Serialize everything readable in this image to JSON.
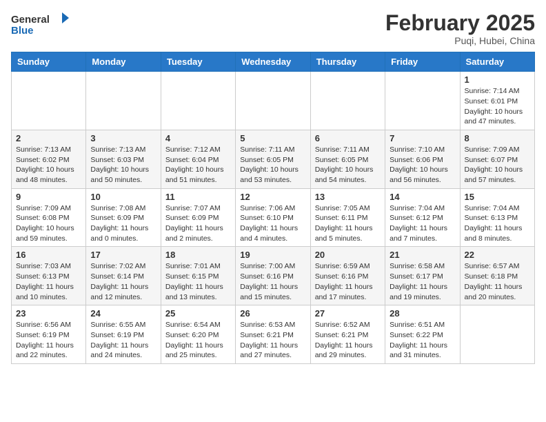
{
  "header": {
    "logo_line1": "General",
    "logo_line2": "Blue",
    "month_title": "February 2025",
    "subtitle": "Puqi, Hubei, China"
  },
  "weekdays": [
    "Sunday",
    "Monday",
    "Tuesday",
    "Wednesday",
    "Thursday",
    "Friday",
    "Saturday"
  ],
  "weeks": [
    [
      {
        "day": "",
        "info": ""
      },
      {
        "day": "",
        "info": ""
      },
      {
        "day": "",
        "info": ""
      },
      {
        "day": "",
        "info": ""
      },
      {
        "day": "",
        "info": ""
      },
      {
        "day": "",
        "info": ""
      },
      {
        "day": "1",
        "info": "Sunrise: 7:14 AM\nSunset: 6:01 PM\nDaylight: 10 hours\nand 47 minutes."
      }
    ],
    [
      {
        "day": "2",
        "info": "Sunrise: 7:13 AM\nSunset: 6:02 PM\nDaylight: 10 hours\nand 48 minutes."
      },
      {
        "day": "3",
        "info": "Sunrise: 7:13 AM\nSunset: 6:03 PM\nDaylight: 10 hours\nand 50 minutes."
      },
      {
        "day": "4",
        "info": "Sunrise: 7:12 AM\nSunset: 6:04 PM\nDaylight: 10 hours\nand 51 minutes."
      },
      {
        "day": "5",
        "info": "Sunrise: 7:11 AM\nSunset: 6:05 PM\nDaylight: 10 hours\nand 53 minutes."
      },
      {
        "day": "6",
        "info": "Sunrise: 7:11 AM\nSunset: 6:05 PM\nDaylight: 10 hours\nand 54 minutes."
      },
      {
        "day": "7",
        "info": "Sunrise: 7:10 AM\nSunset: 6:06 PM\nDaylight: 10 hours\nand 56 minutes."
      },
      {
        "day": "8",
        "info": "Sunrise: 7:09 AM\nSunset: 6:07 PM\nDaylight: 10 hours\nand 57 minutes."
      }
    ],
    [
      {
        "day": "9",
        "info": "Sunrise: 7:09 AM\nSunset: 6:08 PM\nDaylight: 10 hours\nand 59 minutes."
      },
      {
        "day": "10",
        "info": "Sunrise: 7:08 AM\nSunset: 6:09 PM\nDaylight: 11 hours\nand 0 minutes."
      },
      {
        "day": "11",
        "info": "Sunrise: 7:07 AM\nSunset: 6:09 PM\nDaylight: 11 hours\nand 2 minutes."
      },
      {
        "day": "12",
        "info": "Sunrise: 7:06 AM\nSunset: 6:10 PM\nDaylight: 11 hours\nand 4 minutes."
      },
      {
        "day": "13",
        "info": "Sunrise: 7:05 AM\nSunset: 6:11 PM\nDaylight: 11 hours\nand 5 minutes."
      },
      {
        "day": "14",
        "info": "Sunrise: 7:04 AM\nSunset: 6:12 PM\nDaylight: 11 hours\nand 7 minutes."
      },
      {
        "day": "15",
        "info": "Sunrise: 7:04 AM\nSunset: 6:13 PM\nDaylight: 11 hours\nand 8 minutes."
      }
    ],
    [
      {
        "day": "16",
        "info": "Sunrise: 7:03 AM\nSunset: 6:13 PM\nDaylight: 11 hours\nand 10 minutes."
      },
      {
        "day": "17",
        "info": "Sunrise: 7:02 AM\nSunset: 6:14 PM\nDaylight: 11 hours\nand 12 minutes."
      },
      {
        "day": "18",
        "info": "Sunrise: 7:01 AM\nSunset: 6:15 PM\nDaylight: 11 hours\nand 13 minutes."
      },
      {
        "day": "19",
        "info": "Sunrise: 7:00 AM\nSunset: 6:16 PM\nDaylight: 11 hours\nand 15 minutes."
      },
      {
        "day": "20",
        "info": "Sunrise: 6:59 AM\nSunset: 6:16 PM\nDaylight: 11 hours\nand 17 minutes."
      },
      {
        "day": "21",
        "info": "Sunrise: 6:58 AM\nSunset: 6:17 PM\nDaylight: 11 hours\nand 19 minutes."
      },
      {
        "day": "22",
        "info": "Sunrise: 6:57 AM\nSunset: 6:18 PM\nDaylight: 11 hours\nand 20 minutes."
      }
    ],
    [
      {
        "day": "23",
        "info": "Sunrise: 6:56 AM\nSunset: 6:19 PM\nDaylight: 11 hours\nand 22 minutes."
      },
      {
        "day": "24",
        "info": "Sunrise: 6:55 AM\nSunset: 6:19 PM\nDaylight: 11 hours\nand 24 minutes."
      },
      {
        "day": "25",
        "info": "Sunrise: 6:54 AM\nSunset: 6:20 PM\nDaylight: 11 hours\nand 25 minutes."
      },
      {
        "day": "26",
        "info": "Sunrise: 6:53 AM\nSunset: 6:21 PM\nDaylight: 11 hours\nand 27 minutes."
      },
      {
        "day": "27",
        "info": "Sunrise: 6:52 AM\nSunset: 6:21 PM\nDaylight: 11 hours\nand 29 minutes."
      },
      {
        "day": "28",
        "info": "Sunrise: 6:51 AM\nSunset: 6:22 PM\nDaylight: 11 hours\nand 31 minutes."
      },
      {
        "day": "",
        "info": ""
      }
    ]
  ]
}
